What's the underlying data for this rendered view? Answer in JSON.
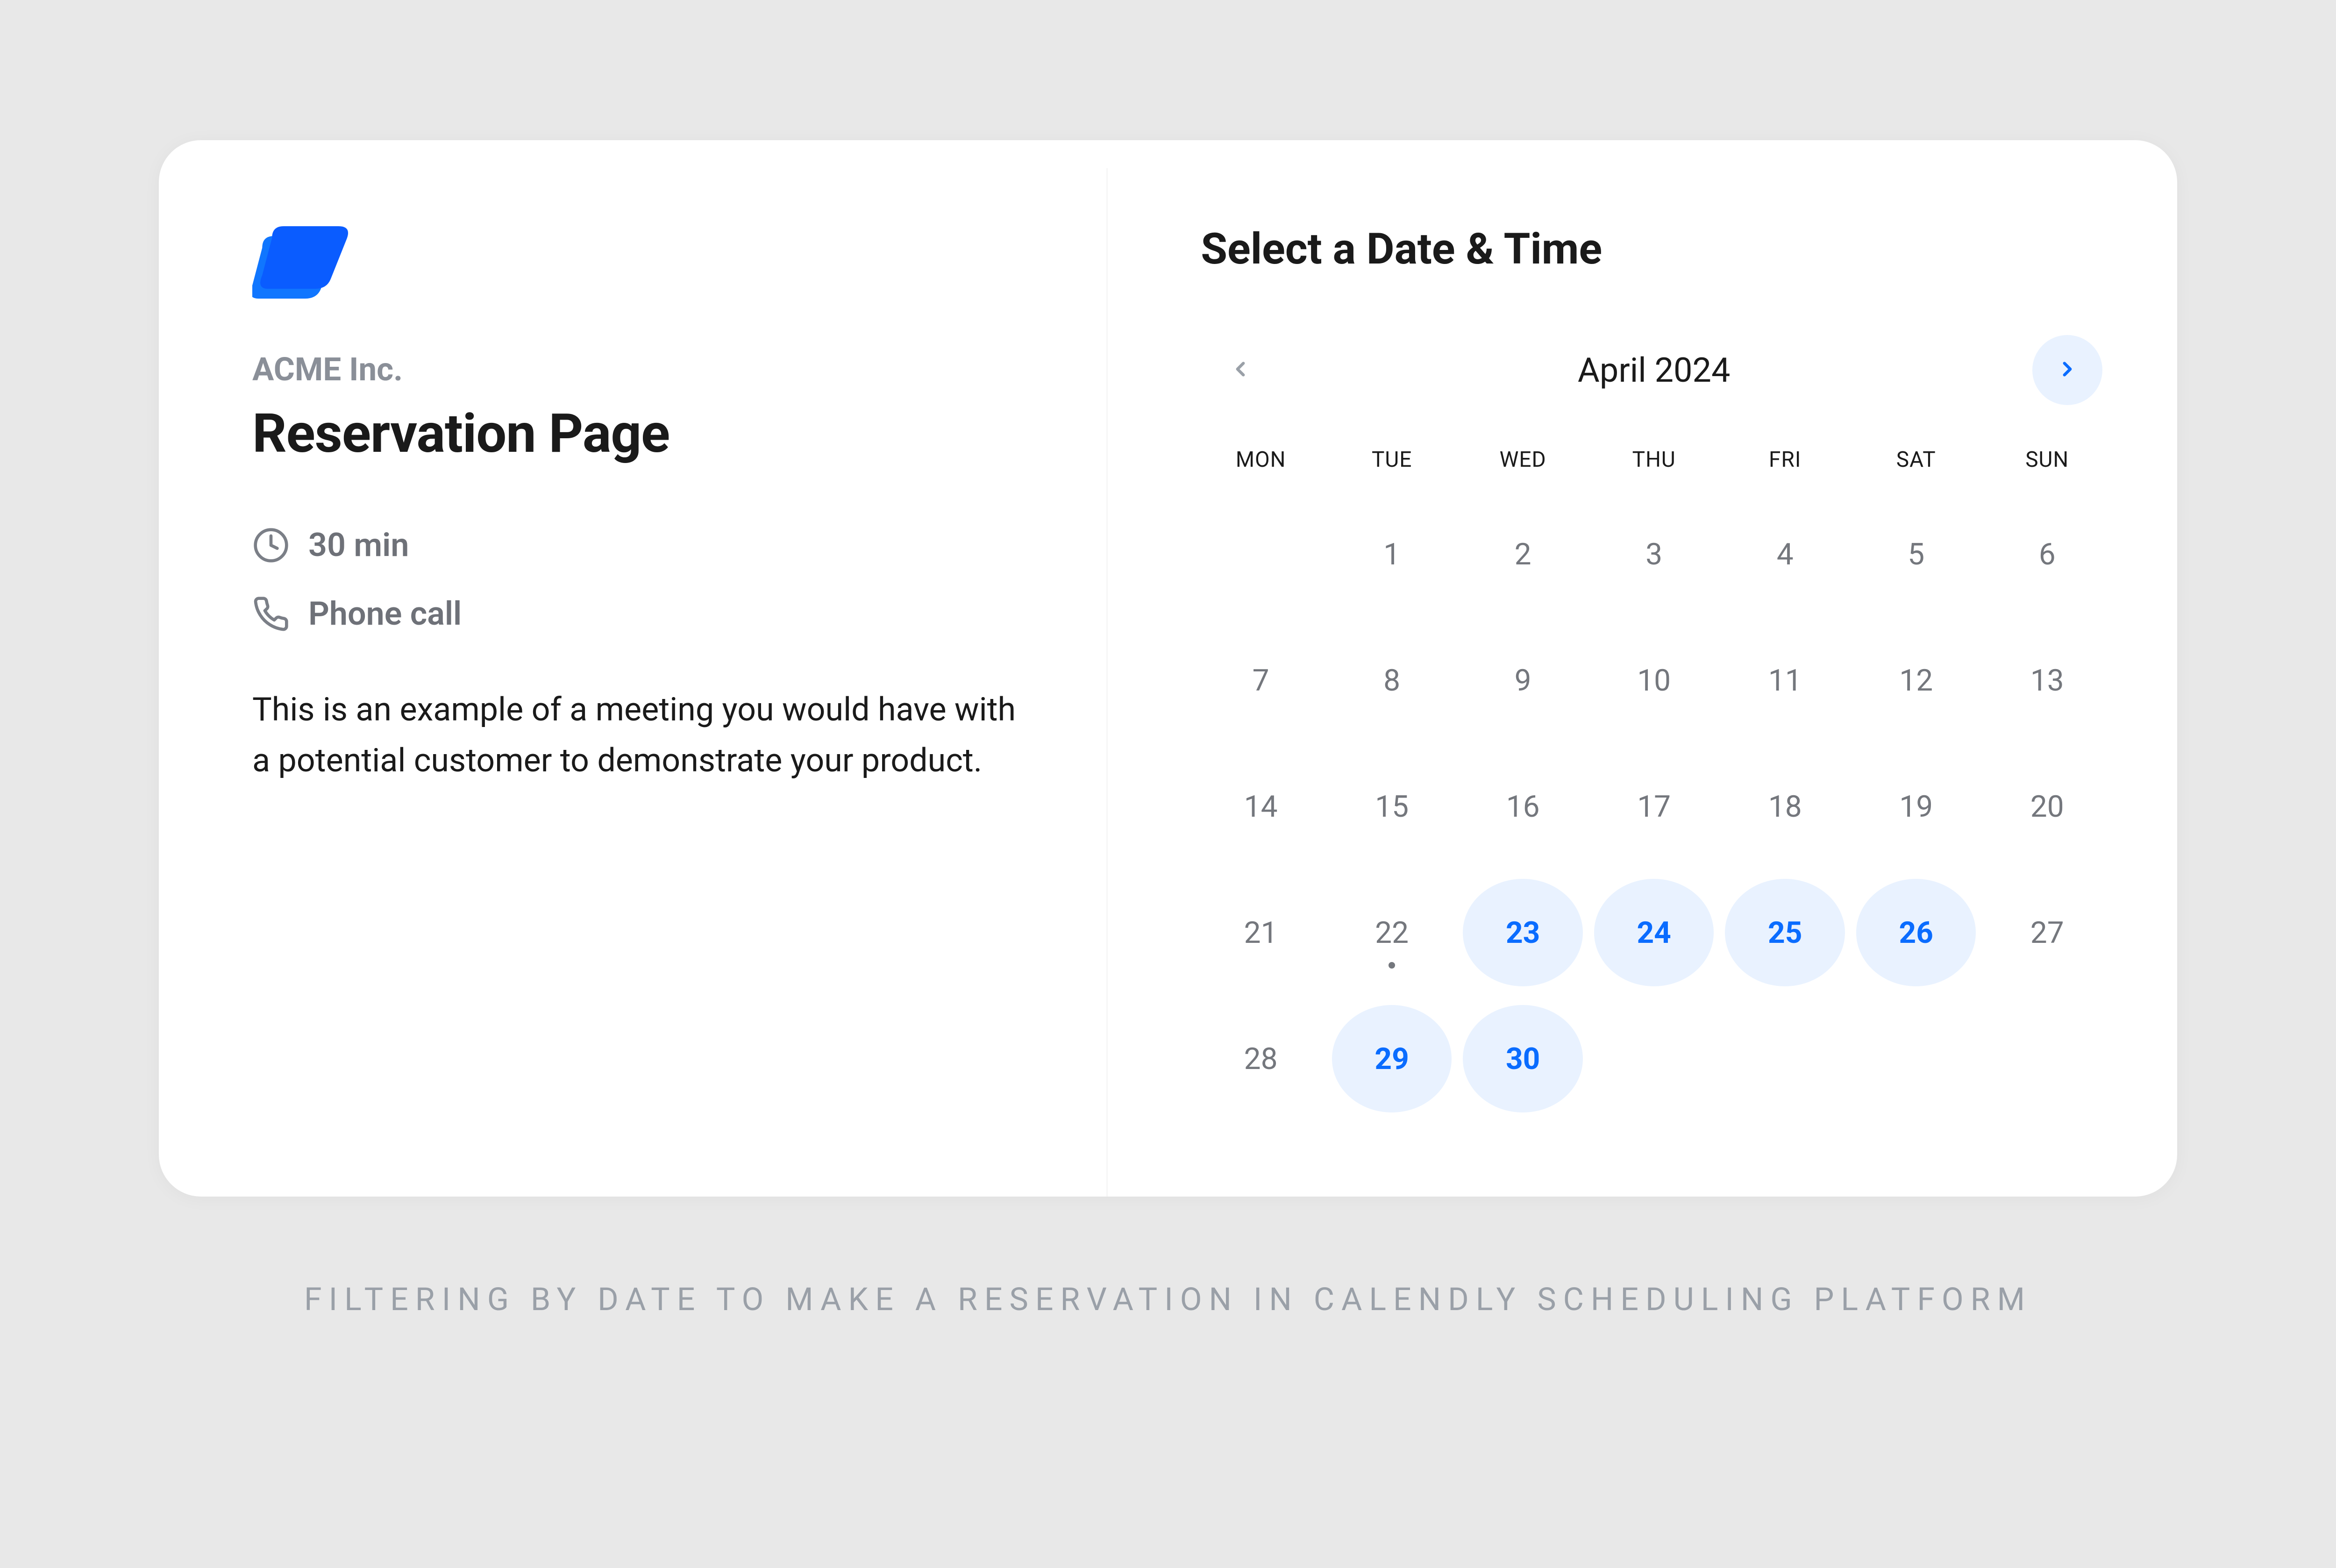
{
  "event": {
    "org": "ACME Inc.",
    "title": "Reservation Page",
    "duration": "30 min",
    "location": "Phone call",
    "description": "This is an example of a meeting you would have with a potential customer to demonstrate your product."
  },
  "calendar": {
    "heading": "Select a Date & Time",
    "month_label": "April 2024",
    "day_headers": [
      "MON",
      "TUE",
      "WED",
      "THU",
      "FRI",
      "SAT",
      "SUN"
    ],
    "weeks": [
      [
        {
          "n": "",
          "avail": false
        },
        {
          "n": "1",
          "avail": false
        },
        {
          "n": "2",
          "avail": false
        },
        {
          "n": "3",
          "avail": false
        },
        {
          "n": "4",
          "avail": false
        },
        {
          "n": "5",
          "avail": false
        },
        {
          "n": "6",
          "avail": false
        }
      ],
      [
        {
          "n": "7",
          "avail": false
        },
        {
          "n": "8",
          "avail": false
        },
        {
          "n": "9",
          "avail": false
        },
        {
          "n": "10",
          "avail": false
        },
        {
          "n": "11",
          "avail": false
        },
        {
          "n": "12",
          "avail": false
        },
        {
          "n": "13",
          "avail": false
        }
      ],
      [
        {
          "n": "14",
          "avail": false
        },
        {
          "n": "15",
          "avail": false
        },
        {
          "n": "16",
          "avail": false
        },
        {
          "n": "17",
          "avail": false
        },
        {
          "n": "18",
          "avail": false
        },
        {
          "n": "19",
          "avail": false
        },
        {
          "n": "20",
          "avail": false
        }
      ],
      [
        {
          "n": "21",
          "avail": false
        },
        {
          "n": "22",
          "avail": false,
          "dot": true
        },
        {
          "n": "23",
          "avail": true
        },
        {
          "n": "24",
          "avail": true
        },
        {
          "n": "25",
          "avail": true
        },
        {
          "n": "26",
          "avail": true
        },
        {
          "n": "27",
          "avail": false
        }
      ],
      [
        {
          "n": "28",
          "avail": false
        },
        {
          "n": "29",
          "avail": true
        },
        {
          "n": "30",
          "avail": true
        },
        {
          "n": "",
          "avail": false
        },
        {
          "n": "",
          "avail": false
        },
        {
          "n": "",
          "avail": false
        },
        {
          "n": "",
          "avail": false
        }
      ]
    ]
  },
  "caption": "FILTERING BY DATE TO MAKE A RESERVATION IN CALENDLY SCHEDULING PLATFORM"
}
